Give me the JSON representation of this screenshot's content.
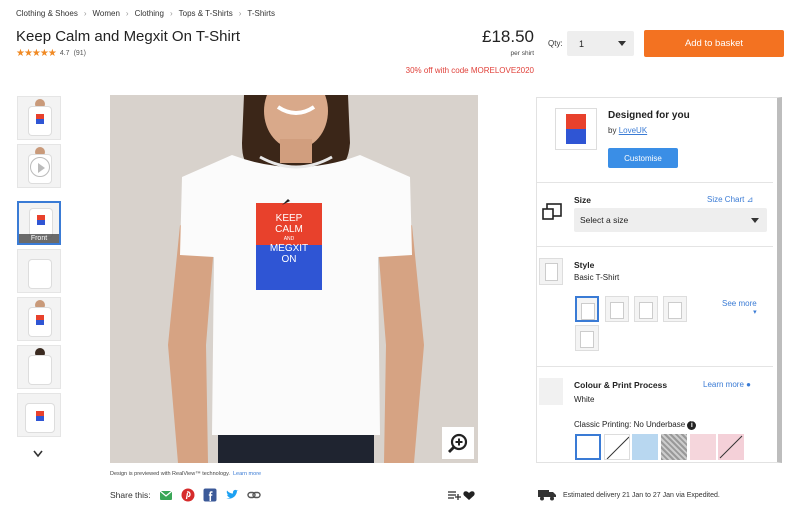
{
  "breadcrumb": [
    "Clothing & Shoes",
    "Women",
    "Clothing",
    "Tops & T-Shirts",
    "T-Shirts"
  ],
  "product": {
    "title": "Keep Calm and Megxit On T-Shirt",
    "rating_value": "4.7",
    "rating_count": "(91)",
    "price": "£18.50",
    "per_unit": "per shirt",
    "promo": "30% off with code MORELOVE2020"
  },
  "qty": {
    "label": "Qty:",
    "value": "1"
  },
  "add_to_basket": "Add to basket",
  "thumbnails": {
    "front_label": "Front"
  },
  "design_text": {
    "line1": "KEEP",
    "line2": "CALM",
    "line3": "AND",
    "line4": "MEGXIT",
    "line5": "ON"
  },
  "preview_note": {
    "text": "Design is previewed with RealView™ technology.",
    "link": "Learn more"
  },
  "share": {
    "label": "Share this:"
  },
  "designed": {
    "title": "Designed for you",
    "by_prefix": "by",
    "by_link": "LoveUK",
    "customise": "Customise"
  },
  "size": {
    "label": "Size",
    "chart_link": "Size Chart",
    "placeholder": "Select a size"
  },
  "style": {
    "label": "Style",
    "value": "Basic T-Shirt",
    "see_more": "See more"
  },
  "colour": {
    "label": "Colour & Print Process",
    "value": "White",
    "learn_more": "Learn more",
    "printing": "Classic Printing: No Underbase"
  },
  "delivery": "Estimated delivery 21 Jan to 27 Jan via Expedited.",
  "colors": {
    "accent_orange": "#f37221",
    "link_blue": "#3a7bd5",
    "promo_red": "#e0413a",
    "star_orange": "#f08a24",
    "design_red": "#e8412c",
    "design_blue": "#2f55d4"
  }
}
